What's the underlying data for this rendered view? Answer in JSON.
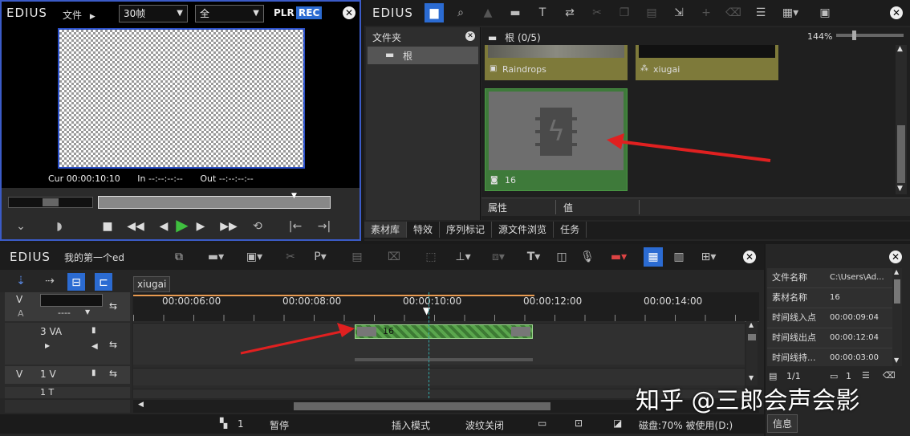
{
  "player": {
    "logo": "EDIUS",
    "file_label": "文件",
    "fps_value": "30帧",
    "quality_value": "全",
    "plr_label": "PLR",
    "rec_label": "REC",
    "cur_label": "Cur",
    "cur_tc": "00:00:10:10",
    "in_label": "In",
    "in_tc": "--:--:--:--",
    "out_label": "Out",
    "out_tc": "--:--:--:--"
  },
  "bin": {
    "logo": "EDIUS",
    "folder_header": "文件夹",
    "folder_root": "根",
    "breadcrumb": "根 (0/5)",
    "zoom": "144%",
    "clips": [
      {
        "name": "Raindrops"
      },
      {
        "name": "xiugai"
      },
      {
        "name": "16"
      }
    ],
    "prop_col1": "属性",
    "prop_col2": "值",
    "tabs": [
      "素材库",
      "特效",
      "序列标记",
      "源文件浏览",
      "任务"
    ]
  },
  "timeline": {
    "logo": "EDIUS",
    "project_name": "我的第一个ed",
    "sequence_tab": "xiugai",
    "ruler_marks": [
      "00:00:06:00",
      "00:00:08:00",
      "00:00:10:00",
      "00:00:12:00",
      "00:00:14:00"
    ],
    "tracks": [
      {
        "type": "V",
        "label": ""
      },
      {
        "type": "A",
        "label": "----"
      },
      {
        "type": "",
        "label": "3 VA"
      },
      {
        "type": "V",
        "label": "1 V"
      },
      {
        "type": "",
        "label": "1 T"
      }
    ],
    "clip_label": "16"
  },
  "info": {
    "rows": [
      {
        "key": "文件名称",
        "value": "C:\\Users\\Ad..."
      },
      {
        "key": "素材名称",
        "value": "16"
      },
      {
        "key": "时间线入点",
        "value": "00:00:09:04"
      },
      {
        "key": "时间线出点",
        "value": "00:00:12:04"
      },
      {
        "key": "时间线持...",
        "value": "00:00:03:00"
      }
    ],
    "page": "1/1",
    "count": "1",
    "tab": "信息"
  },
  "status": {
    "num": "1",
    "state": "暂停",
    "insert_mode": "插入模式",
    "ripple": "波纹关闭",
    "disk": "磁盘:70% 被使用(D:)"
  },
  "watermark": "知乎 @三郎会声会影",
  "colors": {
    "accent": "#2b6bd2",
    "clip_green": "#57a94a",
    "rec_blue": "#2b6bd2",
    "arrow_red": "#e02020"
  }
}
